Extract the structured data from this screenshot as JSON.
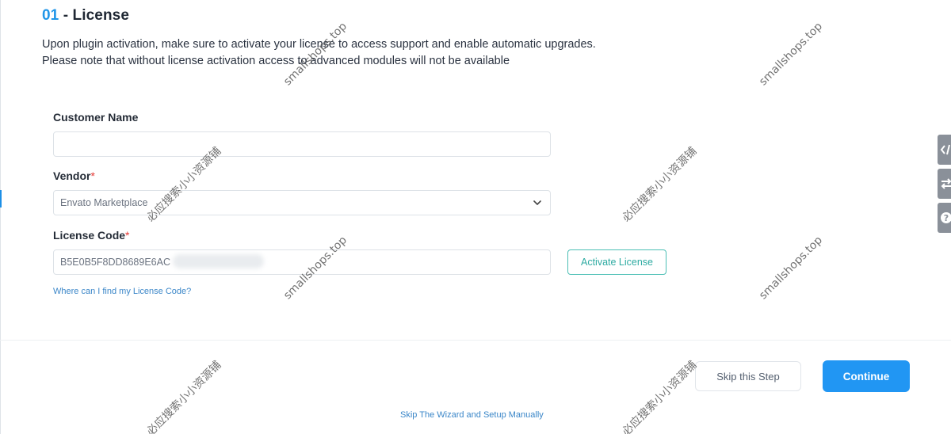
{
  "header": {
    "step_number": "01",
    "step_separator": "- License",
    "description_line1": "Upon plugin activation, make sure to activate your license to access support and enable automatic upgrades.",
    "description_line2": "Please note that without license activation access to advanced modules will not be available"
  },
  "form": {
    "customer_name_label": "Customer Name",
    "customer_name_value": "",
    "vendor_label": "Vendor",
    "vendor_required_mark": "*",
    "vendor_value": "Envato Marketplace",
    "license_label": "License Code",
    "license_required_mark": "*",
    "license_value": "B5E0B5F8DD8689E6AC",
    "activate_label": "Activate License",
    "help_link": "Where can I find my License Code?"
  },
  "footer": {
    "skip_step_label": "Skip this Step",
    "continue_label": "Continue",
    "skip_wizard_link": "Skip The Wizard and Setup Manually"
  },
  "side_tools": [
    "code-icon",
    "swap-icon",
    "help-icon"
  ],
  "watermarks": {
    "domain": "smallshops.top",
    "cn": "必应搜索小小资源铺"
  },
  "colors": {
    "accent_blue": "#2196f3",
    "teal": "#2eaba2",
    "required_red": "#e53935"
  }
}
